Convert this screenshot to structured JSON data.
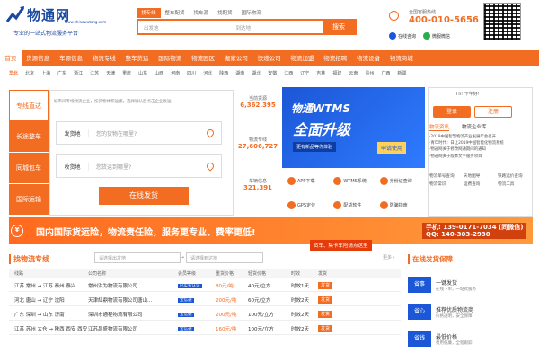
{
  "logo": {
    "name": "物通网",
    "url": "www.chinawutong.com",
    "slogan": "专业的一站式物流服务平台"
  },
  "search": {
    "tabs": [
      "找专线",
      "整车配货",
      "找车源",
      "找配货",
      "国际物流"
    ],
    "placeholder_from": "出发地",
    "placeholder_to": "到达地",
    "button": "搜索"
  },
  "hotline": {
    "label": "全国客服热线",
    "number": "400-010-5656",
    "links": [
      "在线咨询",
      "微服微信"
    ]
  },
  "nav": [
    "首页",
    "货源信息",
    "车源信息",
    "物流专线",
    "整车货运",
    "国际物流",
    "物流园区",
    "搬家公司",
    "快递公司",
    "物流加盟",
    "物流招聘",
    "物流设备",
    "物流商城"
  ],
  "cities": {
    "label": "华北",
    "items": [
      "北京",
      "上海",
      "广东",
      "浙江",
      "江苏",
      "天津",
      "重庆",
      "山东",
      "山西",
      "河南",
      "四川",
      "河北",
      "陕西",
      "湖南",
      "湖北",
      "安徽",
      "江西",
      "辽宁",
      "吉林",
      "福建",
      "云南",
      "贵州",
      "广西",
      "新疆"
    ]
  },
  "sidetabs": [
    "专线直达",
    "长途整车",
    "同城包车",
    "国际运输"
  ],
  "form": {
    "note": "城市间专线物流企业，按货物体积运输，选择确认后点击企业发运",
    "ship_label": "发货地",
    "ship_ph": "您的货物在哪里?",
    "recv_label": "收货地",
    "recv_ph": "您货运到哪里?",
    "submit": "在线发货"
  },
  "stats": [
    {
      "label": "当前货源",
      "value": "6,362,395"
    },
    {
      "label": "物流专线",
      "value": "27,606,727"
    },
    {
      "label": "车辆信息",
      "value": "321,391"
    }
  ],
  "banner": {
    "title": "物通WTMS",
    "big": "全面升级",
    "sub": "更有新品等你体验",
    "btn": "申请使用"
  },
  "services": [
    "APP下载",
    "WTMS系统",
    "身份证查询",
    "GPS定位",
    "配货软件",
    "防骗指南"
  ],
  "account": {
    "hello": "Hi! 下午好!",
    "login": "登录",
    "register": "注册",
    "tabs": [
      "物流资讯",
      "物流企业库"
    ],
    "news": [
      "·2019中国智慧物流产业发展年会召开",
      "·青年时代：日让2019中国智能化物流系统",
      "·物通网关于修改网通期间的通知",
      "·物通网关于版本文字服务项目"
    ],
    "tools": [
      "物流单号查询",
      "天地图导",
      "铁路运价查询",
      "物流常识",
      "运费查询",
      "物流工具"
    ]
  },
  "ad": {
    "icon": "¥",
    "text": "国内国际货运险，物流责任险，服务更专业、费率更低!",
    "tag": "货车、集卡车险请点这里",
    "phone1": "手机: 139-0171-7034 (同微信)",
    "phone2": "QQ: 140-303-2930"
  },
  "list": {
    "title": "找物流专线",
    "from_ph": "请选择出发地",
    "to_ph": "请选择到达地",
    "more": "更多 ›",
    "headers": [
      "线路",
      "公司名称",
      "会员等级",
      "重货价格",
      "轻货价格",
      "时效",
      "发货"
    ],
    "rows": [
      [
        "江苏 常州 → 江苏 泰州 泰兴",
        "常州洪为物流有限公司",
        "已实名认证",
        "80元/吨",
        "40元/立方",
        "时效1天",
        "发货"
      ],
      [
        "河北 唐山 → 辽宁 沈阳",
        "天津紅鼎物流有限公司唐山...",
        "宝信通",
        "200元/吨",
        "60元/立方",
        "时效2天",
        "发货"
      ],
      [
        "广东 深圳 → 山东 济南",
        "深圳市通程物流有限公司",
        "宝信通",
        "200元/吨",
        "100元/立方",
        "时效2天",
        "发货"
      ],
      [
        "江苏 苏州 太仓 → 陕西 西安 西安",
        "江苏昌盛物流有限公司",
        "宝信通",
        "160元/吨",
        "100元/立方",
        "时效2天",
        "发货"
      ]
    ]
  },
  "guarantee": {
    "title": "在线发货保障",
    "items": [
      {
        "icon": "省事",
        "title": "一键发货",
        "desc": "在线下单，一站式服务"
      },
      {
        "icon": "省心",
        "title": "推荐优质物流商",
        "desc": "价格透明，安全保障"
      },
      {
        "icon": "省钱",
        "title": "最低价格",
        "desc": "费用低廉，全程跟踪"
      }
    ]
  },
  "colors": {
    "accent": "#f26c22",
    "brand": "#1a4aa0",
    "banner": "#1b57d6"
  }
}
